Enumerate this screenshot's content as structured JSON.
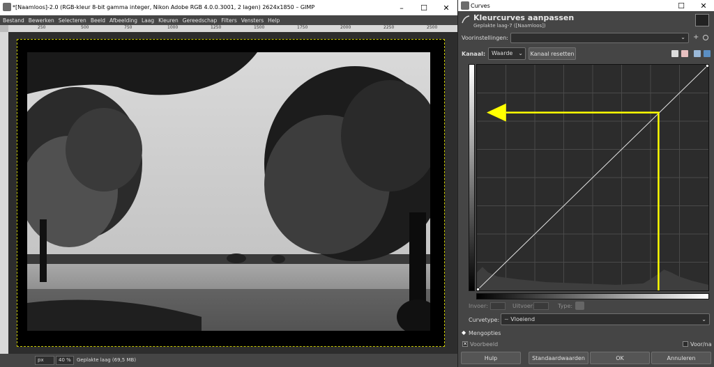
{
  "gimp": {
    "title": "*[Naamloos]-2.0 (RGB-kleur 8-bit gamma integer, Nikon Adobe RGB 4.0.0.3001, 2 lagen) 2624x1850 – GIMP",
    "menu": [
      "Bestand",
      "Bewerken",
      "Selecteren",
      "Beeld",
      "Afbeelding",
      "Laag",
      "Kleuren",
      "Gereedschap",
      "Filters",
      "Vensters",
      "Help"
    ],
    "ruler_ticks": [
      "250",
      "500",
      "750",
      "1000",
      "1250",
      "1500",
      "1750",
      "2000",
      "2250",
      "2500"
    ],
    "status": {
      "unit": "px",
      "zoom": "40 %",
      "info": "Geplakte laag (69,5 MB)"
    },
    "window_controls": {
      "minimize": "–",
      "maximize": "☐",
      "close": "✕"
    }
  },
  "curves": {
    "window_title": "Curves",
    "header_title": "Kleurcurves aanpassen",
    "header_subtitle": "Geplakte laag-7 ([Naamloos])",
    "presets_label": "Voorinstellingen:",
    "presets_value": "",
    "channel_label": "Kanaal:",
    "channel_value": "Waarde",
    "reset_channel": "Kanaal resetten",
    "input_label": "Invoer:",
    "output_label": "Uitvoer:",
    "type_label": "Type:",
    "curve_type_label": "Curvetype:",
    "curve_type_value": "Vloeiend",
    "blend_options": "Mengopties",
    "preview_label": "Voorbeeld",
    "before_after_label": "Voor/na",
    "buttons": {
      "help": "Hulp",
      "defaults": "Standaardwaarden",
      "ok": "OK",
      "cancel": "Annuleren"
    },
    "window_controls": {
      "maximize": "☐",
      "close": "✕"
    },
    "colors": {
      "annotation": "#ffff00",
      "curve": "#e8e8e8",
      "graph_bg": "#2c2c2c"
    }
  }
}
